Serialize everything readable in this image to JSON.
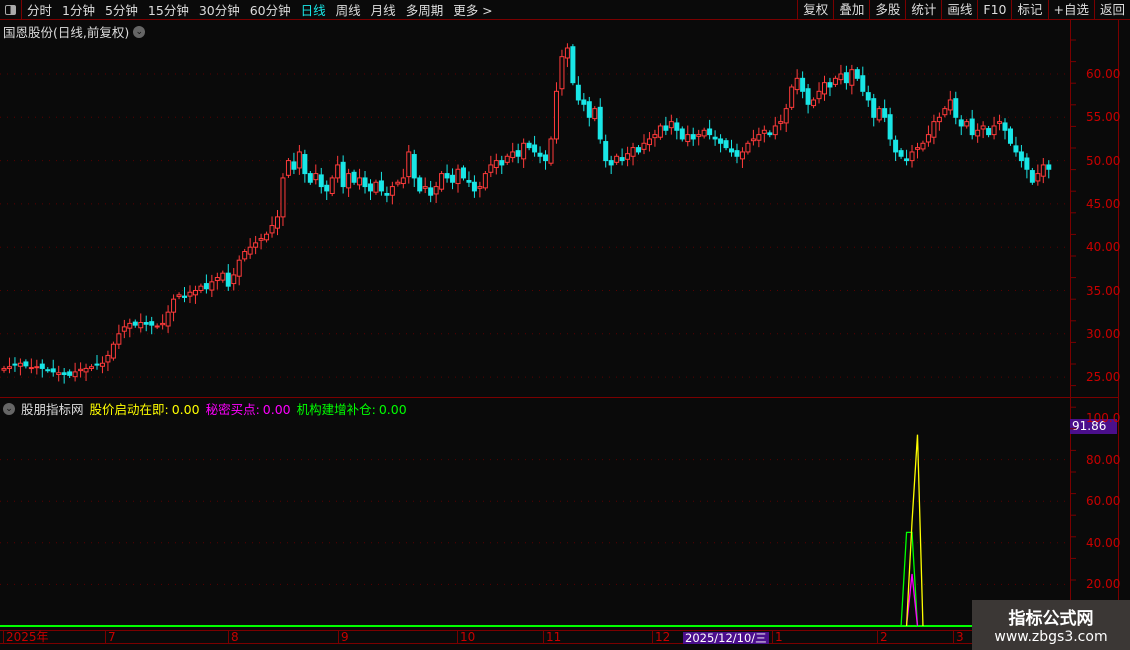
{
  "toolbar": {
    "periods": [
      "分时",
      "1分钟",
      "5分钟",
      "15分钟",
      "30分钟",
      "60分钟",
      "日线",
      "周线",
      "月线",
      "多周期",
      "更多 >"
    ],
    "active": "日线",
    "right_buttons": [
      "复权",
      "叠加",
      "多股",
      "统计",
      "画线",
      "F10",
      "标记",
      "+自选",
      "返回"
    ]
  },
  "chart_title": "国恩股份(日线,前复权)",
  "price_axis": [
    "60.00",
    "55.00",
    "50.00",
    "45.00",
    "40.00",
    "35.00",
    "30.00",
    "25.00"
  ],
  "colors": {
    "up": "#ff3b3b",
    "down": "#19e6e6",
    "axis": "#c80000",
    "yellow": "#ffff00",
    "magenta": "#ff00ff",
    "green": "#00ff00"
  },
  "chart_data": {
    "type": "candlestick",
    "ylim": [
      23,
      65
    ],
    "closes": [
      26.0,
      26.2,
      26.4,
      26.6,
      26.3,
      26.1,
      26.2,
      26.0,
      25.8,
      25.6,
      25.5,
      25.3,
      25.2,
      25.6,
      25.9,
      26.0,
      26.2,
      26.4,
      26.6,
      27.5,
      28.8,
      30.0,
      30.8,
      31.2,
      31.0,
      31.3,
      31.1,
      31.0,
      30.9,
      31.2,
      32.5,
      34.0,
      34.5,
      34.2,
      34.8,
      35.0,
      35.5,
      35.2,
      36.0,
      36.5,
      37.0,
      35.5,
      36.8,
      38.5,
      39.5,
      40.0,
      40.5,
      41.0,
      41.5,
      42.5,
      43.5,
      48.0,
      50.0,
      49.0,
      51.0,
      48.5,
      47.5,
      48.5,
      47.0,
      46.5,
      48.0,
      49.5,
      47.0,
      48.5,
      47.5,
      48.0,
      47.0,
      46.5,
      47.5,
      46.5,
      46.0,
      47.0,
      47.5,
      48.0,
      51.0,
      48.0,
      46.5,
      47.0,
      46.0,
      47.0,
      48.5,
      48.0,
      47.5,
      49.0,
      48.0,
      47.5,
      46.5,
      47.0,
      48.5,
      49.5,
      50.0,
      49.5,
      50.5,
      51.0,
      50.5,
      52.0,
      51.5,
      51.0,
      50.5,
      50.0,
      52.5,
      58.0,
      62.0,
      63.0,
      59.0,
      57.0,
      56.5,
      55.0,
      56.0,
      52.5,
      50.0,
      49.5,
      50.5,
      50.0,
      50.8,
      51.5,
      51.0,
      52.0,
      52.5,
      53.0,
      54.0,
      53.5,
      54.5,
      53.5,
      52.5,
      53.0,
      52.5,
      53.0,
      53.5,
      53.0,
      52.5,
      52.0,
      51.5,
      51.0,
      50.5,
      51.0,
      52.0,
      52.5,
      53.0,
      53.5,
      53.0,
      54.0,
      54.5,
      56.0,
      58.5,
      59.5,
      58.0,
      56.5,
      57.0,
      58.0,
      59.0,
      58.5,
      59.5,
      60.0,
      59.0,
      60.5,
      59.5,
      58.0,
      57.0,
      55.0,
      56.0,
      55.0,
      52.5,
      51.0,
      50.5,
      50.0,
      51.0,
      51.5,
      52.0,
      53.0,
      54.5,
      55.0,
      56.0,
      57.0,
      55.0,
      54.0,
      54.5,
      53.0,
      53.5,
      54.0,
      53.0,
      54.0,
      54.5,
      53.5,
      52.0,
      51.0,
      50.0,
      49.0,
      47.5,
      48.5,
      49.5,
      49.0
    ],
    "months": [
      "2025年",
      "7",
      "8",
      "9",
      "10",
      "11",
      "12",
      "1",
      "2",
      "3"
    ]
  },
  "indicator": {
    "name": "股朋指标网",
    "lines": [
      {
        "label": "股价启动在即:",
        "value": "0.00",
        "color": "#ffff00"
      },
      {
        "label": "秘密买点:",
        "value": "0.00",
        "color": "#ff00ff"
      },
      {
        "label": "机构建增补仓:",
        "value": "0.00",
        "color": "#00ff00"
      }
    ],
    "axis": [
      "100.0",
      "80.00",
      "60.00",
      "40.00",
      "20.00"
    ],
    "current_value": "91.86",
    "series": {
      "yellow": [
        [
          165,
          0
        ],
        [
          166,
          50
        ],
        [
          167,
          92
        ],
        [
          168,
          0
        ]
      ],
      "magenta": [
        [
          165,
          0
        ],
        [
          166,
          25
        ],
        [
          167,
          0
        ]
      ],
      "green": [
        [
          164,
          0
        ],
        [
          165,
          45
        ],
        [
          166,
          45
        ],
        [
          167,
          0
        ]
      ]
    }
  },
  "cursor_date": "2025/12/10/三",
  "watermark": {
    "line1": "指标公式网",
    "line2": "www.zbgs3.com"
  }
}
